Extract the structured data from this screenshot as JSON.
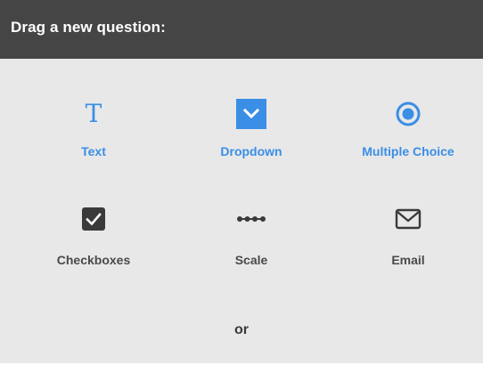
{
  "header": {
    "title": "Drag a new question:"
  },
  "question_types": [
    {
      "label": "Text",
      "icon": "text-t-icon",
      "state": "active"
    },
    {
      "label": "Dropdown",
      "icon": "dropdown-chevron-icon",
      "state": "active"
    },
    {
      "label": "Multiple Choice",
      "icon": "radio-button-icon",
      "state": "active"
    },
    {
      "label": "Checkboxes",
      "icon": "checkbox-checked-icon",
      "state": "inactive"
    },
    {
      "label": "Scale",
      "icon": "scale-dots-icon",
      "state": "inactive"
    },
    {
      "label": "Email",
      "icon": "envelope-icon",
      "state": "inactive"
    }
  ],
  "separator": {
    "text": "or"
  },
  "colors": {
    "header_bg": "#454545",
    "panel_bg": "#e8e8e8",
    "accent": "#3a8ee6",
    "inactive_text": "#4a4a4a"
  }
}
